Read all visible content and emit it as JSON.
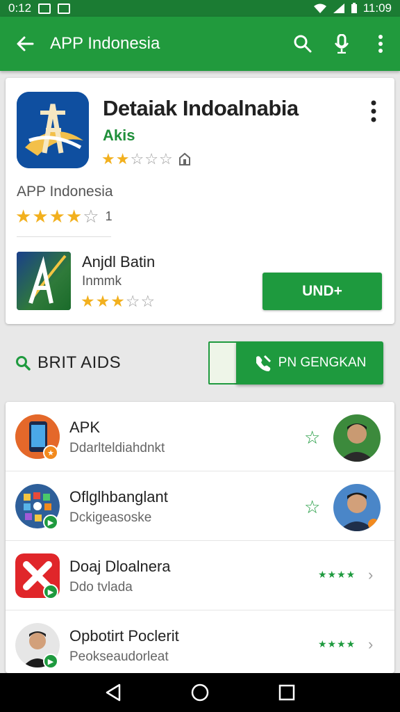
{
  "status_bar": {
    "time_left": "0:12",
    "time_right": "11:09"
  },
  "app_bar": {
    "title": "APP Indonesia"
  },
  "app_detail": {
    "name": "Detaiak Indoalnabia",
    "subtitle": "Akis",
    "rating": 2,
    "rating_max": 5
  },
  "publisher": {
    "label": "APP Indonesia",
    "rating": 4,
    "rating_max": 5,
    "count": "1"
  },
  "related_app": {
    "title": "Anjdl Batin",
    "subtitle": "Inmmk",
    "rating": 3,
    "rating_max": 5,
    "button_label": "UND+"
  },
  "section": {
    "label": "BRIT AIDS",
    "button_label": "PN GENGKAN"
  },
  "list": [
    {
      "title": "APK",
      "subtitle": "Ddarlteldiahdnkt",
      "trailing": "star-avatar",
      "badge_color": "#f28a1e"
    },
    {
      "title": "Oflglhbanglant",
      "subtitle": "Dckigeasoske",
      "trailing": "star-avatar",
      "badge_color": "#1e9a3e"
    },
    {
      "title": "Doaj Dloalnera",
      "subtitle": "Ddo tvlada",
      "trailing": "stars-chevron",
      "badge_color": "#1e9a3e"
    },
    {
      "title": "Opbotirt Poclerit",
      "subtitle": "Peokseaudorleat",
      "trailing": "stars-chevron",
      "badge_color": "#1e9a3e"
    }
  ],
  "colors": {
    "primary": "#219a3d",
    "status_bar": "#1b7c33",
    "star": "#f2b01e"
  }
}
